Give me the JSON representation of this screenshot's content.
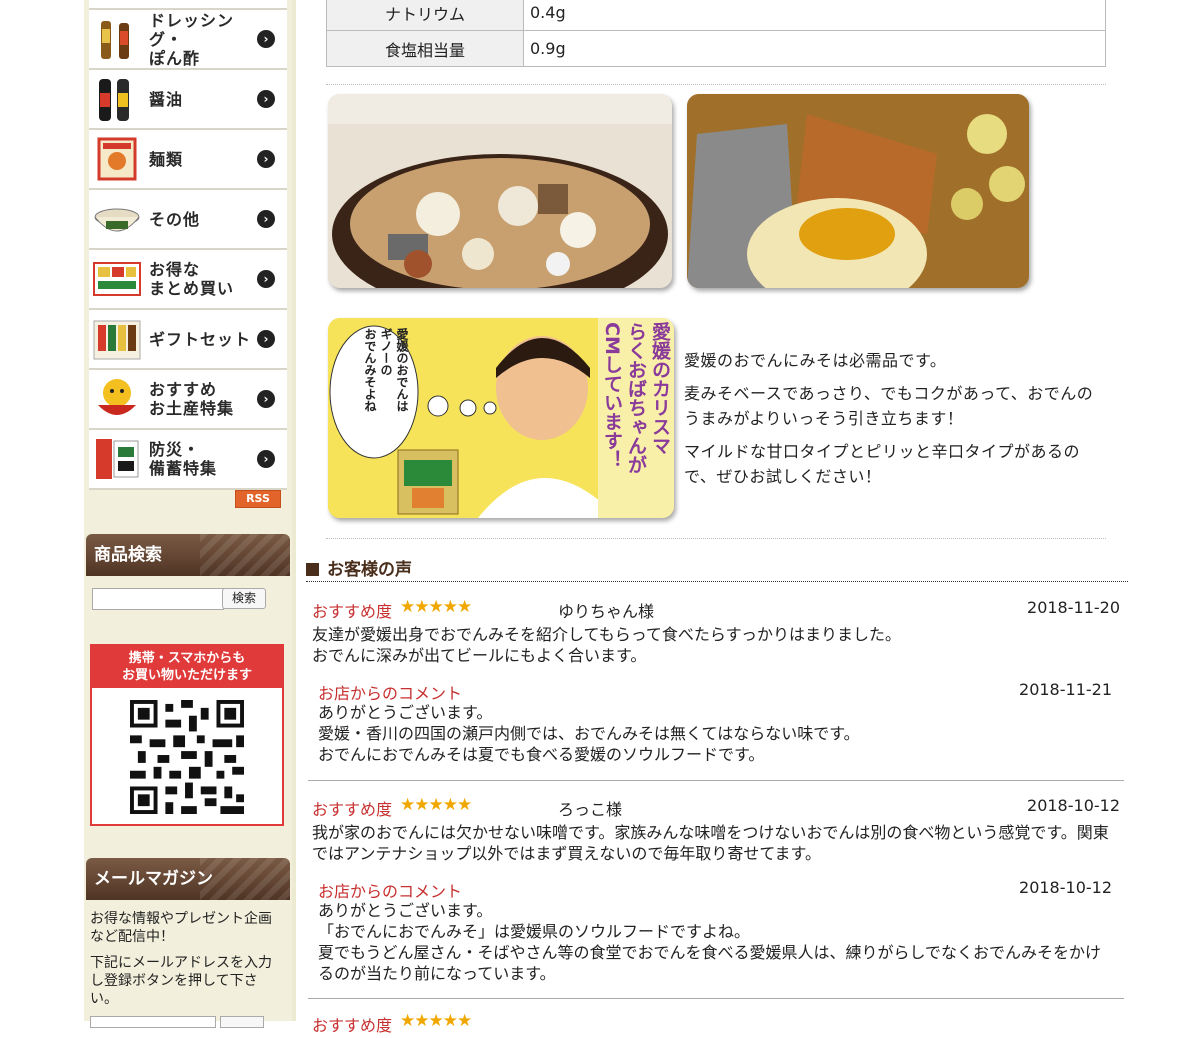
{
  "sidebar": {
    "categories": [
      {
        "label": "ドレッシング・\nぽん酢",
        "icon": "dressing-bottles-icon"
      },
      {
        "label": "醤油",
        "icon": "soy-sauce-bottles-icon"
      },
      {
        "label": "麺類",
        "icon": "noodle-pack-icon"
      },
      {
        "label": "その他",
        "icon": "bowl-icon"
      },
      {
        "label": "お得な\nまとめ買い",
        "icon": "bundle-pack-icon"
      },
      {
        "label": "ギフトセット",
        "icon": "gift-set-icon"
      },
      {
        "label": "おすすめ\nお土産特集",
        "icon": "souvenir-character-icon"
      },
      {
        "label": "防災・\n備蓄特集",
        "icon": "emergency-stock-icon"
      }
    ],
    "rss": "RSS",
    "search_heading": "商品検索",
    "search_button": "検索",
    "search_value": "",
    "mobile_heading_line1": "携帯・スマホからも",
    "mobile_heading_line2": "お買い物いただけます",
    "mail_heading": "メールマガジン",
    "mail_text1": "お得な情報やプレゼント企画など配信中！",
    "mail_text2": "下記にメールアドレスを入力し登録ボタンを押して下さい。"
  },
  "nutrition": [
    {
      "key": "ナトリウム",
      "value": "0.4g"
    },
    {
      "key": "食塩相当量",
      "value": "0.9g"
    }
  ],
  "promo": {
    "bubble_text": "愛媛のおでんは\nギノーの\nおでんみそよね",
    "vertical_text": "愛媛のカリスマ\nらくおばちゃんが\nCMしています！",
    "description": [
      "愛媛のおでんにみそは必需品です。",
      "麦みそベースであっさり、でもコクがあって、おでんのうまみがよりいっそう引き立ちます！",
      "マイルドな甘口タイプとピリッと辛口タイプがあるので、ぜひお試しください！"
    ]
  },
  "voices": {
    "title": "お客様の声",
    "rating_label": "おすすめ度",
    "stars": "★★★★★",
    "reply_label": "お店からのコメント",
    "reviews": [
      {
        "name": "ゆりちゃん様",
        "date": "2018-11-20",
        "body": "友達が愛媛出身でおでんみそを紹介してもらって食べたらすっかりはまりました。\nおでんに深みが出てビールにもよく合います。",
        "reply_date": "2018-11-21",
        "reply": "ありがとうございます。\n愛媛・香川の四国の瀬戸内側では、おでんみそは無くてはならない味です。\nおでんにおでんみそは夏でも食べる愛媛のソウルフードです。"
      },
      {
        "name": "ろっこ様",
        "date": "2018-10-12",
        "body": "我が家のおでんには欠かせない味噌です。家族みんな味噌をつけないおでんは別の食べ物という感覚です。関東ではアンテナショップ以外ではまず買えないので毎年取り寄せてます。",
        "reply_date": "2018-10-12",
        "reply": "ありがとうございます。\n「おでんにおでんみそ」は愛媛県のソウルフードですよね。\n夏でもうどん屋さん・そばやさん等の食堂でおでんを食べる愛媛県人は、練りがらしでなくおでんみそをかけるのが当たり前になっています。"
      }
    ]
  }
}
